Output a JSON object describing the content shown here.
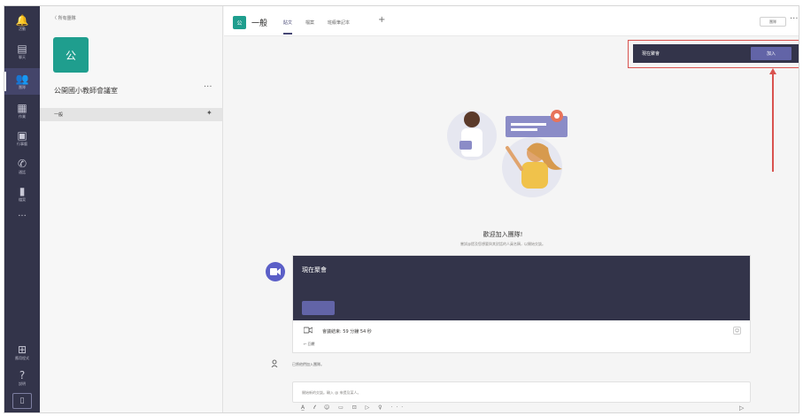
{
  "rail": {
    "items": [
      {
        "glyph": "🔔",
        "label": "活動",
        "icon": "bell-icon"
      },
      {
        "glyph": "▤",
        "label": "聊天",
        "icon": "chat-icon"
      },
      {
        "glyph": "👥",
        "label": "團隊",
        "icon": "teams-icon"
      },
      {
        "glyph": "▦",
        "label": "作業",
        "icon": "assignments-icon"
      },
      {
        "glyph": "▣",
        "label": "行事曆",
        "icon": "calendar-icon"
      },
      {
        "glyph": "✆",
        "label": "通話",
        "icon": "calls-icon"
      },
      {
        "glyph": "▮",
        "label": "檔案",
        "icon": "files-icon"
      }
    ],
    "more": "···",
    "bottom": [
      {
        "glyph": "⊞",
        "label": "應用程式",
        "icon": "apps-icon"
      },
      {
        "glyph": "?",
        "label": "說明",
        "icon": "help-icon"
      }
    ],
    "device_glyph": "▯"
  },
  "team_panel": {
    "back_label": "〈 所有團隊",
    "avatar_letter": "公",
    "team_name": "公開國小教師會議室",
    "more": "···",
    "channel": "一般",
    "pin": "✦"
  },
  "channel_header": {
    "avatar_letter": "公",
    "title": "一般",
    "tabs": [
      "貼文",
      "檔案",
      "班級筆記本"
    ],
    "add": "+",
    "team_button": "團隊",
    "more": "···"
  },
  "banner": {
    "label": "現在聚會",
    "join": "加入"
  },
  "welcome": {
    "title": "歡迎加入團隊!",
    "subtitle": "嘗試@提及您想要與其對話的人員名稱，以開始交談。"
  },
  "card": {
    "title": "現在聚會",
    "ended": "會議結束: 59 分鐘 54 秒",
    "reply": "↩ 回覆",
    "react": "☺"
  },
  "system_message": "已將他們加入團隊。",
  "compose": {
    "placeholder": "開始新的交談。輸入 @ 來提及某人。",
    "tools": "A̲ 𝓉 ☺ ▭ ⊡ ▷ ♀ ···",
    "send": "▷"
  },
  "colors": {
    "rail": "#33344a",
    "accent": "#6264a7",
    "team_avatar": "#1f9e8e",
    "annotation": "#d9534f"
  }
}
